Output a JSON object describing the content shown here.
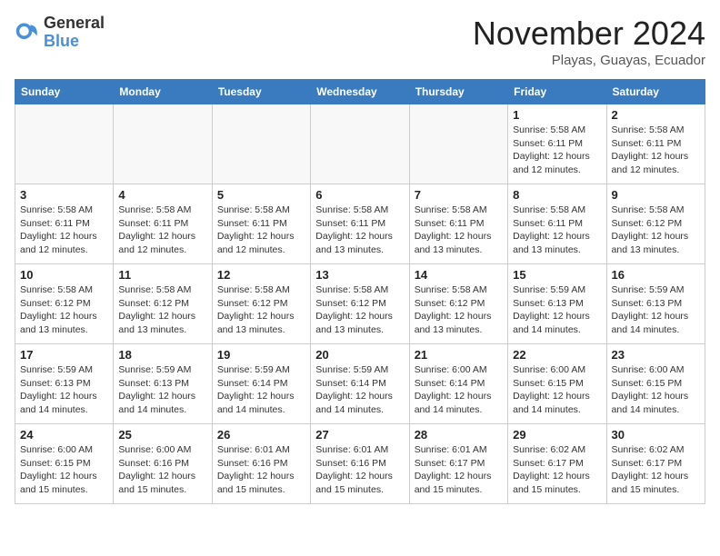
{
  "header": {
    "logo_general": "General",
    "logo_blue": "Blue",
    "month_title": "November 2024",
    "location": "Playas, Guayas, Ecuador"
  },
  "weekdays": [
    "Sunday",
    "Monday",
    "Tuesday",
    "Wednesday",
    "Thursday",
    "Friday",
    "Saturday"
  ],
  "weeks": [
    [
      {
        "day": "",
        "info": ""
      },
      {
        "day": "",
        "info": ""
      },
      {
        "day": "",
        "info": ""
      },
      {
        "day": "",
        "info": ""
      },
      {
        "day": "",
        "info": ""
      },
      {
        "day": "1",
        "info": "Sunrise: 5:58 AM\nSunset: 6:11 PM\nDaylight: 12 hours\nand 12 minutes."
      },
      {
        "day": "2",
        "info": "Sunrise: 5:58 AM\nSunset: 6:11 PM\nDaylight: 12 hours\nand 12 minutes."
      }
    ],
    [
      {
        "day": "3",
        "info": "Sunrise: 5:58 AM\nSunset: 6:11 PM\nDaylight: 12 hours\nand 12 minutes."
      },
      {
        "day": "4",
        "info": "Sunrise: 5:58 AM\nSunset: 6:11 PM\nDaylight: 12 hours\nand 12 minutes."
      },
      {
        "day": "5",
        "info": "Sunrise: 5:58 AM\nSunset: 6:11 PM\nDaylight: 12 hours\nand 12 minutes."
      },
      {
        "day": "6",
        "info": "Sunrise: 5:58 AM\nSunset: 6:11 PM\nDaylight: 12 hours\nand 13 minutes."
      },
      {
        "day": "7",
        "info": "Sunrise: 5:58 AM\nSunset: 6:11 PM\nDaylight: 12 hours\nand 13 minutes."
      },
      {
        "day": "8",
        "info": "Sunrise: 5:58 AM\nSunset: 6:11 PM\nDaylight: 12 hours\nand 13 minutes."
      },
      {
        "day": "9",
        "info": "Sunrise: 5:58 AM\nSunset: 6:12 PM\nDaylight: 12 hours\nand 13 minutes."
      }
    ],
    [
      {
        "day": "10",
        "info": "Sunrise: 5:58 AM\nSunset: 6:12 PM\nDaylight: 12 hours\nand 13 minutes."
      },
      {
        "day": "11",
        "info": "Sunrise: 5:58 AM\nSunset: 6:12 PM\nDaylight: 12 hours\nand 13 minutes."
      },
      {
        "day": "12",
        "info": "Sunrise: 5:58 AM\nSunset: 6:12 PM\nDaylight: 12 hours\nand 13 minutes."
      },
      {
        "day": "13",
        "info": "Sunrise: 5:58 AM\nSunset: 6:12 PM\nDaylight: 12 hours\nand 13 minutes."
      },
      {
        "day": "14",
        "info": "Sunrise: 5:58 AM\nSunset: 6:12 PM\nDaylight: 12 hours\nand 13 minutes."
      },
      {
        "day": "15",
        "info": "Sunrise: 5:59 AM\nSunset: 6:13 PM\nDaylight: 12 hours\nand 14 minutes."
      },
      {
        "day": "16",
        "info": "Sunrise: 5:59 AM\nSunset: 6:13 PM\nDaylight: 12 hours\nand 14 minutes."
      }
    ],
    [
      {
        "day": "17",
        "info": "Sunrise: 5:59 AM\nSunset: 6:13 PM\nDaylight: 12 hours\nand 14 minutes."
      },
      {
        "day": "18",
        "info": "Sunrise: 5:59 AM\nSunset: 6:13 PM\nDaylight: 12 hours\nand 14 minutes."
      },
      {
        "day": "19",
        "info": "Sunrise: 5:59 AM\nSunset: 6:14 PM\nDaylight: 12 hours\nand 14 minutes."
      },
      {
        "day": "20",
        "info": "Sunrise: 5:59 AM\nSunset: 6:14 PM\nDaylight: 12 hours\nand 14 minutes."
      },
      {
        "day": "21",
        "info": "Sunrise: 6:00 AM\nSunset: 6:14 PM\nDaylight: 12 hours\nand 14 minutes."
      },
      {
        "day": "22",
        "info": "Sunrise: 6:00 AM\nSunset: 6:15 PM\nDaylight: 12 hours\nand 14 minutes."
      },
      {
        "day": "23",
        "info": "Sunrise: 6:00 AM\nSunset: 6:15 PM\nDaylight: 12 hours\nand 14 minutes."
      }
    ],
    [
      {
        "day": "24",
        "info": "Sunrise: 6:00 AM\nSunset: 6:15 PM\nDaylight: 12 hours\nand 15 minutes."
      },
      {
        "day": "25",
        "info": "Sunrise: 6:00 AM\nSunset: 6:16 PM\nDaylight: 12 hours\nand 15 minutes."
      },
      {
        "day": "26",
        "info": "Sunrise: 6:01 AM\nSunset: 6:16 PM\nDaylight: 12 hours\nand 15 minutes."
      },
      {
        "day": "27",
        "info": "Sunrise: 6:01 AM\nSunset: 6:16 PM\nDaylight: 12 hours\nand 15 minutes."
      },
      {
        "day": "28",
        "info": "Sunrise: 6:01 AM\nSunset: 6:17 PM\nDaylight: 12 hours\nand 15 minutes."
      },
      {
        "day": "29",
        "info": "Sunrise: 6:02 AM\nSunset: 6:17 PM\nDaylight: 12 hours\nand 15 minutes."
      },
      {
        "day": "30",
        "info": "Sunrise: 6:02 AM\nSunset: 6:17 PM\nDaylight: 12 hours\nand 15 minutes."
      }
    ]
  ]
}
